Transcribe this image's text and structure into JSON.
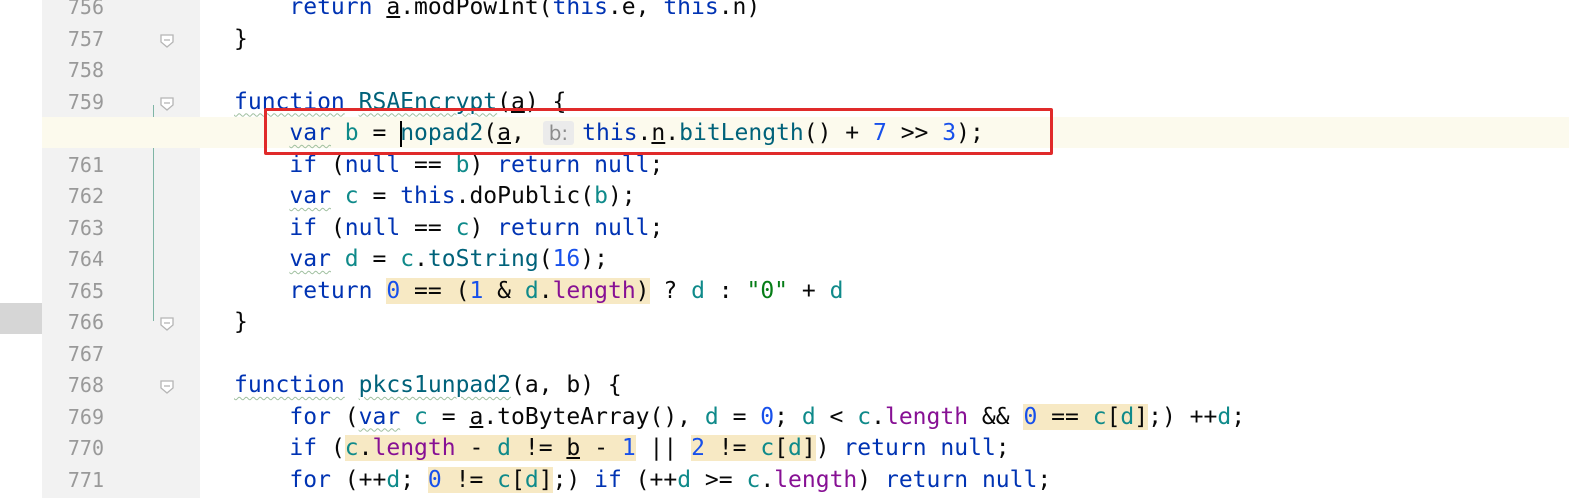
{
  "editor": {
    "line_numbers": [
      "756",
      "757",
      "758",
      "759",
      "760",
      "761",
      "762",
      "763",
      "764",
      "765",
      "766",
      "767",
      "768",
      "769",
      "770",
      "771"
    ],
    "colors": {
      "keyword": "#0033b3",
      "function": "#00627a",
      "variable": "#0f8a8a",
      "property": "#871094",
      "number": "#1750eb",
      "string": "#067d17",
      "highlight_box": "#e02a2a"
    },
    "hint_label": "b:",
    "lines": [
      [
        {
          "t": "    ",
          "c": "plain"
        },
        {
          "t": "return",
          "c": "kw"
        },
        {
          "t": " ",
          "c": "plain"
        },
        {
          "t": "a",
          "c": "param"
        },
        {
          "t": ".modPowInt(",
          "c": "plain"
        },
        {
          "t": "this",
          "c": "kw"
        },
        {
          "t": ".e, ",
          "c": "plain"
        },
        {
          "t": "this",
          "c": "kw"
        },
        {
          "t": ".n)",
          "c": "plain"
        }
      ],
      [
        {
          "t": "}",
          "c": "plain"
        }
      ],
      [],
      [
        {
          "t": "function",
          "c": "kw wavy"
        },
        {
          "t": " ",
          "c": "plain"
        },
        {
          "t": "RSAEncrypt",
          "c": "fn wavy"
        },
        {
          "t": "(",
          "c": "plain"
        },
        {
          "t": "a",
          "c": "param"
        },
        {
          "t": ") {",
          "c": "plain"
        }
      ],
      [
        {
          "t": "    ",
          "c": "plain"
        },
        {
          "t": "var",
          "c": "kw wavy"
        },
        {
          "t": " ",
          "c": "plain"
        },
        {
          "t": "b",
          "c": "var"
        },
        {
          "t": " = ",
          "c": "plain"
        },
        {
          "t": "CARET",
          "c": "caret"
        },
        {
          "t": "nopad2",
          "c": "fn"
        },
        {
          "t": "(",
          "c": "plain"
        },
        {
          "t": "a",
          "c": "param"
        },
        {
          "t": ", ",
          "c": "plain"
        },
        {
          "t": "HINT",
          "c": "hint"
        },
        {
          "t": "this",
          "c": "kw"
        },
        {
          "t": ".",
          "c": "plain"
        },
        {
          "t": "n",
          "c": "param"
        },
        {
          "t": ".",
          "c": "plain"
        },
        {
          "t": "bitLength",
          "c": "fn"
        },
        {
          "t": "() + ",
          "c": "plain"
        },
        {
          "t": "7",
          "c": "num"
        },
        {
          "t": " >> ",
          "c": "plain"
        },
        {
          "t": "3",
          "c": "num"
        },
        {
          "t": ");",
          "c": "plain"
        }
      ],
      [
        {
          "t": "    ",
          "c": "plain"
        },
        {
          "t": "if",
          "c": "kw"
        },
        {
          "t": " (",
          "c": "plain"
        },
        {
          "t": "null",
          "c": "kw"
        },
        {
          "t": " == ",
          "c": "plain"
        },
        {
          "t": "b",
          "c": "var"
        },
        {
          "t": ") ",
          "c": "plain"
        },
        {
          "t": "return",
          "c": "kw"
        },
        {
          "t": " ",
          "c": "plain"
        },
        {
          "t": "null",
          "c": "kw"
        },
        {
          "t": ";",
          "c": "plain"
        }
      ],
      [
        {
          "t": "    ",
          "c": "plain"
        },
        {
          "t": "var",
          "c": "kw wavy"
        },
        {
          "t": " ",
          "c": "plain"
        },
        {
          "t": "c",
          "c": "var"
        },
        {
          "t": " = ",
          "c": "plain"
        },
        {
          "t": "this",
          "c": "kw"
        },
        {
          "t": ".doPublic(",
          "c": "plain"
        },
        {
          "t": "b",
          "c": "var"
        },
        {
          "t": ");",
          "c": "plain"
        }
      ],
      [
        {
          "t": "    ",
          "c": "plain"
        },
        {
          "t": "if",
          "c": "kw"
        },
        {
          "t": " (",
          "c": "plain"
        },
        {
          "t": "null",
          "c": "kw"
        },
        {
          "t": " == ",
          "c": "plain"
        },
        {
          "t": "c",
          "c": "var"
        },
        {
          "t": ") ",
          "c": "plain"
        },
        {
          "t": "return",
          "c": "kw"
        },
        {
          "t": " ",
          "c": "plain"
        },
        {
          "t": "null",
          "c": "kw"
        },
        {
          "t": ";",
          "c": "plain"
        }
      ],
      [
        {
          "t": "    ",
          "c": "plain"
        },
        {
          "t": "var",
          "c": "kw wavy"
        },
        {
          "t": " ",
          "c": "plain"
        },
        {
          "t": "d",
          "c": "var"
        },
        {
          "t": " = ",
          "c": "plain"
        },
        {
          "t": "c",
          "c": "var"
        },
        {
          "t": ".",
          "c": "plain"
        },
        {
          "t": "toString",
          "c": "fn"
        },
        {
          "t": "(",
          "c": "plain"
        },
        {
          "t": "16",
          "c": "num"
        },
        {
          "t": ");",
          "c": "plain"
        }
      ],
      [
        {
          "t": "    ",
          "c": "plain"
        },
        {
          "t": "return",
          "c": "kw"
        },
        {
          "t": " ",
          "c": "plain"
        },
        {
          "t": "0",
          "c": "num hl"
        },
        {
          "t": " == (",
          "c": "plain hl"
        },
        {
          "t": "1",
          "c": "num hl"
        },
        {
          "t": " & ",
          "c": "plain hl"
        },
        {
          "t": "d",
          "c": "var hl"
        },
        {
          "t": ".",
          "c": "plain hl"
        },
        {
          "t": "length",
          "c": "prop hl"
        },
        {
          "t": ")",
          "c": "plain hl"
        },
        {
          "t": " ? ",
          "c": "plain"
        },
        {
          "t": "d",
          "c": "var"
        },
        {
          "t": " : ",
          "c": "plain"
        },
        {
          "t": "\"0\"",
          "c": "str"
        },
        {
          "t": " + ",
          "c": "plain"
        },
        {
          "t": "d",
          "c": "var"
        }
      ],
      [
        {
          "t": "}",
          "c": "plain"
        }
      ],
      [],
      [
        {
          "t": "function",
          "c": "kw wavy"
        },
        {
          "t": " ",
          "c": "plain"
        },
        {
          "t": "pkcs1unpad2",
          "c": "fn wavy"
        },
        {
          "t": "(a, b) {",
          "c": "plain"
        }
      ],
      [
        {
          "t": "    ",
          "c": "plain"
        },
        {
          "t": "for",
          "c": "kw"
        },
        {
          "t": " (",
          "c": "plain"
        },
        {
          "t": "var",
          "c": "kw wavy"
        },
        {
          "t": " ",
          "c": "plain"
        },
        {
          "t": "c",
          "c": "var"
        },
        {
          "t": " = ",
          "c": "plain"
        },
        {
          "t": "a",
          "c": "param"
        },
        {
          "t": ".toByteArray(), ",
          "c": "plain"
        },
        {
          "t": "d",
          "c": "var"
        },
        {
          "t": " = ",
          "c": "plain"
        },
        {
          "t": "0",
          "c": "num"
        },
        {
          "t": "; ",
          "c": "plain"
        },
        {
          "t": "d",
          "c": "var"
        },
        {
          "t": " < ",
          "c": "plain"
        },
        {
          "t": "c",
          "c": "var"
        },
        {
          "t": ".",
          "c": "plain"
        },
        {
          "t": "length",
          "c": "prop"
        },
        {
          "t": " && ",
          "c": "plain"
        },
        {
          "t": "0",
          "c": "num hl"
        },
        {
          "t": " == ",
          "c": "plain hl"
        },
        {
          "t": "c",
          "c": "var hl"
        },
        {
          "t": "[",
          "c": "plain hl"
        },
        {
          "t": "d",
          "c": "var hl"
        },
        {
          "t": "]",
          "c": "plain hl"
        },
        {
          "t": ";) ++",
          "c": "plain"
        },
        {
          "t": "d",
          "c": "var"
        },
        {
          "t": ";",
          "c": "plain"
        }
      ],
      [
        {
          "t": "    ",
          "c": "plain"
        },
        {
          "t": "if",
          "c": "kw"
        },
        {
          "t": " (",
          "c": "plain"
        },
        {
          "t": "c",
          "c": "var hl"
        },
        {
          "t": ".",
          "c": "plain hl"
        },
        {
          "t": "length",
          "c": "prop hl"
        },
        {
          "t": " - ",
          "c": "plain hl"
        },
        {
          "t": "d",
          "c": "var hl"
        },
        {
          "t": " != ",
          "c": "plain hl"
        },
        {
          "t": "b",
          "c": "param hl"
        },
        {
          "t": " - ",
          "c": "plain hl"
        },
        {
          "t": "1",
          "c": "num hl"
        },
        {
          "t": " || ",
          "c": "plain"
        },
        {
          "t": "2",
          "c": "num hl"
        },
        {
          "t": " != ",
          "c": "plain hl"
        },
        {
          "t": "c",
          "c": "var hl"
        },
        {
          "t": "[",
          "c": "plain hl"
        },
        {
          "t": "d",
          "c": "var hl"
        },
        {
          "t": "]",
          "c": "plain hl"
        },
        {
          "t": ") ",
          "c": "plain"
        },
        {
          "t": "return",
          "c": "kw"
        },
        {
          "t": " ",
          "c": "plain"
        },
        {
          "t": "null",
          "c": "kw"
        },
        {
          "t": ";",
          "c": "plain"
        }
      ],
      [
        {
          "t": "    ",
          "c": "plain"
        },
        {
          "t": "for",
          "c": "kw"
        },
        {
          "t": " (++",
          "c": "plain"
        },
        {
          "t": "d",
          "c": "var"
        },
        {
          "t": "; ",
          "c": "plain"
        },
        {
          "t": "0",
          "c": "num hl"
        },
        {
          "t": " != ",
          "c": "plain hl"
        },
        {
          "t": "c",
          "c": "var hl"
        },
        {
          "t": "[",
          "c": "plain hl"
        },
        {
          "t": "d",
          "c": "var hl"
        },
        {
          "t": "]",
          "c": "plain hl"
        },
        {
          "t": ";) ",
          "c": "plain"
        },
        {
          "t": "if",
          "c": "kw"
        },
        {
          "t": " (++",
          "c": "plain"
        },
        {
          "t": "d",
          "c": "var"
        },
        {
          "t": " >= ",
          "c": "plain"
        },
        {
          "t": "c",
          "c": "var"
        },
        {
          "t": ".",
          "c": "plain"
        },
        {
          "t": "length",
          "c": "prop"
        },
        {
          "t": ") ",
          "c": "plain"
        },
        {
          "t": "return",
          "c": "kw"
        },
        {
          "t": " ",
          "c": "plain"
        },
        {
          "t": "null",
          "c": "kw"
        },
        {
          "t": ";",
          "c": "plain"
        }
      ]
    ]
  }
}
